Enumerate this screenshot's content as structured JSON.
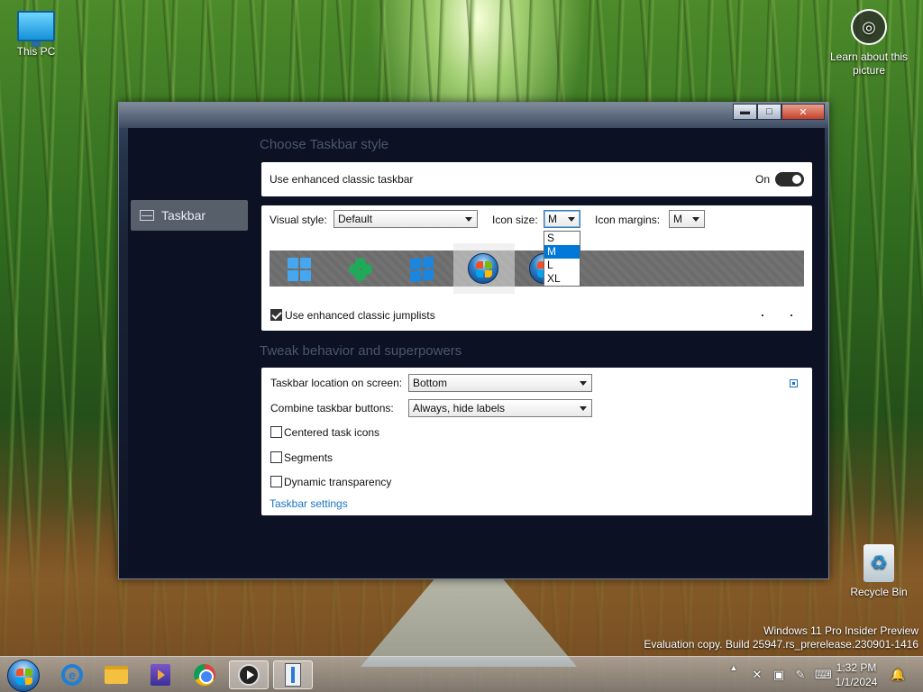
{
  "desktop": {
    "icons": [
      {
        "label": "This PC"
      },
      {
        "label": "Recycle Bin"
      }
    ],
    "learn_about": "Learn about this picture",
    "watermark": {
      "line1": "Windows 11 Pro Insider Preview",
      "line2": "Evaluation copy. Build 25947.rs_prerelease.230901-1416"
    }
  },
  "window": {
    "controls": {
      "minimize": "▬",
      "maximize": "□",
      "close": "✕"
    },
    "nav": {
      "taskbar": "Taskbar"
    },
    "style_section": {
      "title": "Choose Taskbar style",
      "enhanced_label": "Use enhanced classic taskbar",
      "enhanced_state": "On",
      "visual_style_label": "Visual style:",
      "visual_style_value": "Default",
      "icon_size_label": "Icon size:",
      "icon_size_value": "M",
      "icon_size_options": [
        "S",
        "M",
        "L",
        "XL"
      ],
      "icon_size_selected": "M",
      "icon_margins_label": "Icon margins:",
      "icon_margins_value": "M",
      "jumplists_label": "Use enhanced classic jumplists",
      "jumplists_checked": true
    },
    "behavior_section": {
      "title": "Tweak behavior and superpowers",
      "location_label": "Taskbar location on screen:",
      "location_value": "Bottom",
      "combine_label": "Combine taskbar buttons:",
      "combine_value": "Always, hide labels",
      "centered_label": "Centered task icons",
      "segments_label": "Segments",
      "transparency_label": "Dynamic transparency",
      "settings_link": "Taskbar settings"
    }
  },
  "taskbar": {
    "apps": [
      "start-button",
      "internet-explorer",
      "file-explorer",
      "media-app",
      "chrome",
      "media-player",
      "settings-app"
    ],
    "tray": {
      "up_arrow": "▲",
      "time": "1:32 PM",
      "date": "1/1/2024"
    }
  },
  "colors": {
    "accent": "#0078d7",
    "link": "#1a73c4",
    "nav_bg": "#575f6b",
    "window_bg": "#0c1124"
  }
}
